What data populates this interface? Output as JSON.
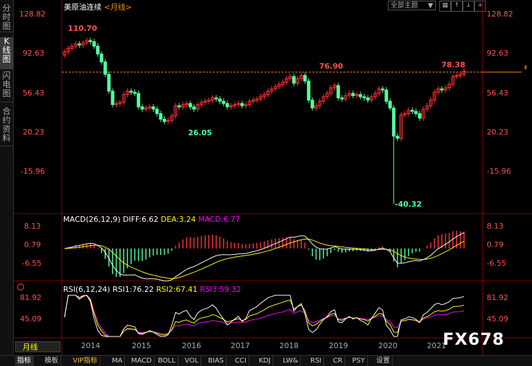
{
  "sidebar": {
    "tabs": [
      {
        "label": "分时图"
      },
      {
        "label": "K线图"
      },
      {
        "label": "闪电图"
      },
      {
        "label": "合约资料"
      }
    ]
  },
  "header": {
    "title": "美原油连续",
    "period_link": "<月线>",
    "theme_select": "全部主题"
  },
  "colors": {
    "up": "#ff3232",
    "down": "#54ffa0",
    "diff": "#ffffff",
    "dea": "#ffff00",
    "macd": "#ff00ff",
    "rsi1": "#ffffff",
    "rsi2": "#ffff00",
    "rsi3": "#ff00ff",
    "dashed": "#ff8c00"
  },
  "price_axis": [
    "128.82",
    "92.63",
    "56.43",
    "20.23",
    "-15.96"
  ],
  "annotations": {
    "high": "110.70",
    "low1": "26.05",
    "low2": "-40.32",
    "mid": "76.90",
    "last": "78.38"
  },
  "macd": {
    "title": "MACD(26,12,9)",
    "diff": "DIFF:6.62",
    "dea": "DEA:3.24",
    "macd": "MACD:6.77",
    "axis": [
      "8.13",
      "0.79",
      "-6.55"
    ]
  },
  "rsi": {
    "title": "RSI(6,12,24)",
    "rsi1": "RSI1:76.22",
    "rsi2": "RSI2:67.41",
    "rsi3": "RSI3:59.32",
    "axis": [
      "81.92",
      "45.09"
    ]
  },
  "x_axis": {
    "period": "月线",
    "years": [
      "2014",
      "2015",
      "2016",
      "2017",
      "2018",
      "2019",
      "2020",
      "2021"
    ]
  },
  "watermark": "FX678",
  "bottom_tabs": [
    "指标",
    "模板",
    "VIP指标",
    "MA",
    "MACD",
    "BOLL",
    "VOL",
    "BIAS",
    "CCI",
    "KDJ",
    "LW&",
    "RSI",
    "CR",
    "PSY",
    "设置"
  ],
  "chart_data": {
    "type": "candlestick",
    "period": "monthly",
    "price_ylim": [
      -40.32,
      128.82
    ],
    "reference_line": 76.9,
    "closes": [
      95,
      98,
      100,
      102,
      101,
      103,
      105,
      104,
      100,
      93,
      86,
      75,
      60,
      48,
      49,
      50,
      57,
      60,
      59,
      58,
      46,
      44,
      45,
      46,
      44,
      40,
      35,
      33,
      34,
      38,
      47,
      46,
      48,
      49,
      46,
      44,
      48,
      50,
      51,
      52,
      54,
      53,
      51,
      49,
      46,
      47,
      48,
      49,
      47,
      48,
      51,
      52,
      53,
      55,
      57,
      60,
      62,
      64,
      66,
      68,
      71,
      73,
      67,
      71,
      74,
      69,
      52,
      45,
      47,
      51,
      55,
      58,
      63,
      65,
      54,
      53,
      56,
      58,
      56,
      57,
      55,
      54,
      52,
      55,
      58,
      62,
      61,
      51,
      45,
      20,
      18,
      39,
      40,
      43,
      42,
      40,
      36,
      44,
      47,
      52,
      59,
      62,
      61,
      63,
      66,
      73,
      74,
      75,
      78
    ],
    "macd_ylim": [
      -13.9,
      9.2
    ],
    "rsi_ylim": [
      15,
      90
    ]
  }
}
